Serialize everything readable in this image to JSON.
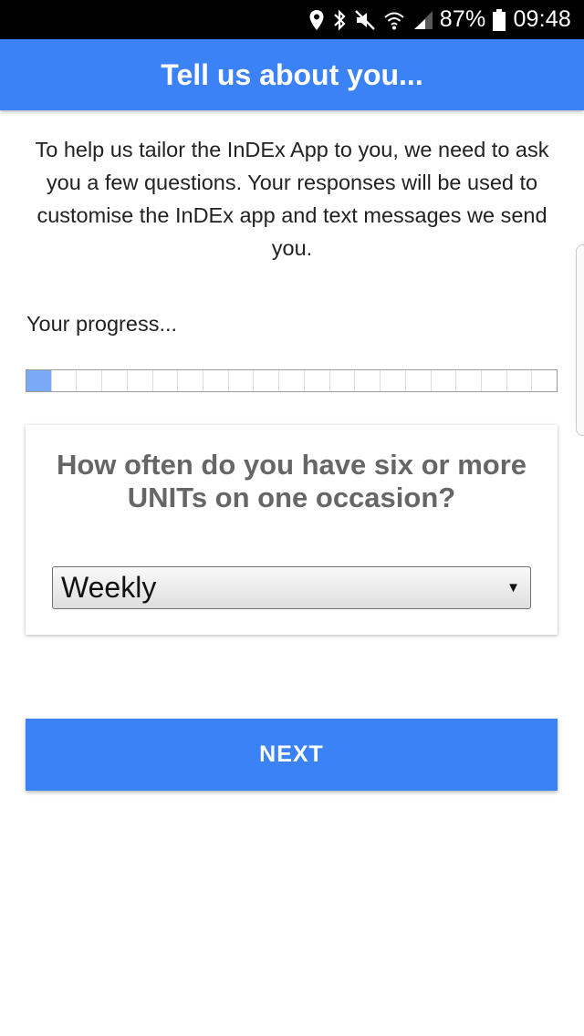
{
  "status_bar": {
    "battery": "87%",
    "time": "09:48",
    "icons": [
      "location-icon",
      "bluetooth-icon",
      "mute-icon",
      "wifi-icon",
      "signal-icon",
      "battery-icon"
    ]
  },
  "header": {
    "title": "Tell us about you..."
  },
  "intro": {
    "text": "To help us tailor the InDEx App to you, we need to ask you a few questions. Your responses will be used to customise the InDEx app and text messages we send you."
  },
  "progress": {
    "label": "Your progress...",
    "completed_steps": 1,
    "total_steps": 21
  },
  "question": {
    "text": "How often do you have six or more UNITs on one occasion?",
    "selected": "Weekly"
  },
  "actions": {
    "next_label": "NEXT"
  },
  "colors": {
    "primary": "#3b82f6",
    "progress_fill": "#7aa9f7",
    "question_text": "#666666"
  }
}
